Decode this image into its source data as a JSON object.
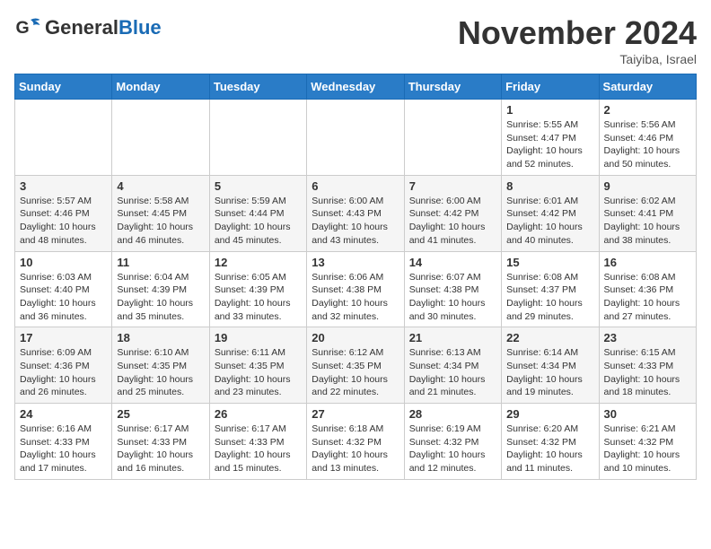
{
  "header": {
    "logo_general": "General",
    "logo_blue": "Blue",
    "month_title": "November 2024",
    "location": "Taiyiba, Israel"
  },
  "weekdays": [
    "Sunday",
    "Monday",
    "Tuesday",
    "Wednesday",
    "Thursday",
    "Friday",
    "Saturday"
  ],
  "weeks": [
    [
      {
        "day": "",
        "info": ""
      },
      {
        "day": "",
        "info": ""
      },
      {
        "day": "",
        "info": ""
      },
      {
        "day": "",
        "info": ""
      },
      {
        "day": "",
        "info": ""
      },
      {
        "day": "1",
        "info": "Sunrise: 5:55 AM\nSunset: 4:47 PM\nDaylight: 10 hours and 52 minutes."
      },
      {
        "day": "2",
        "info": "Sunrise: 5:56 AM\nSunset: 4:46 PM\nDaylight: 10 hours and 50 minutes."
      }
    ],
    [
      {
        "day": "3",
        "info": "Sunrise: 5:57 AM\nSunset: 4:46 PM\nDaylight: 10 hours and 48 minutes."
      },
      {
        "day": "4",
        "info": "Sunrise: 5:58 AM\nSunset: 4:45 PM\nDaylight: 10 hours and 46 minutes."
      },
      {
        "day": "5",
        "info": "Sunrise: 5:59 AM\nSunset: 4:44 PM\nDaylight: 10 hours and 45 minutes."
      },
      {
        "day": "6",
        "info": "Sunrise: 6:00 AM\nSunset: 4:43 PM\nDaylight: 10 hours and 43 minutes."
      },
      {
        "day": "7",
        "info": "Sunrise: 6:00 AM\nSunset: 4:42 PM\nDaylight: 10 hours and 41 minutes."
      },
      {
        "day": "8",
        "info": "Sunrise: 6:01 AM\nSunset: 4:42 PM\nDaylight: 10 hours and 40 minutes."
      },
      {
        "day": "9",
        "info": "Sunrise: 6:02 AM\nSunset: 4:41 PM\nDaylight: 10 hours and 38 minutes."
      }
    ],
    [
      {
        "day": "10",
        "info": "Sunrise: 6:03 AM\nSunset: 4:40 PM\nDaylight: 10 hours and 36 minutes."
      },
      {
        "day": "11",
        "info": "Sunrise: 6:04 AM\nSunset: 4:39 PM\nDaylight: 10 hours and 35 minutes."
      },
      {
        "day": "12",
        "info": "Sunrise: 6:05 AM\nSunset: 4:39 PM\nDaylight: 10 hours and 33 minutes."
      },
      {
        "day": "13",
        "info": "Sunrise: 6:06 AM\nSunset: 4:38 PM\nDaylight: 10 hours and 32 minutes."
      },
      {
        "day": "14",
        "info": "Sunrise: 6:07 AM\nSunset: 4:38 PM\nDaylight: 10 hours and 30 minutes."
      },
      {
        "day": "15",
        "info": "Sunrise: 6:08 AM\nSunset: 4:37 PM\nDaylight: 10 hours and 29 minutes."
      },
      {
        "day": "16",
        "info": "Sunrise: 6:08 AM\nSunset: 4:36 PM\nDaylight: 10 hours and 27 minutes."
      }
    ],
    [
      {
        "day": "17",
        "info": "Sunrise: 6:09 AM\nSunset: 4:36 PM\nDaylight: 10 hours and 26 minutes."
      },
      {
        "day": "18",
        "info": "Sunrise: 6:10 AM\nSunset: 4:35 PM\nDaylight: 10 hours and 25 minutes."
      },
      {
        "day": "19",
        "info": "Sunrise: 6:11 AM\nSunset: 4:35 PM\nDaylight: 10 hours and 23 minutes."
      },
      {
        "day": "20",
        "info": "Sunrise: 6:12 AM\nSunset: 4:35 PM\nDaylight: 10 hours and 22 minutes."
      },
      {
        "day": "21",
        "info": "Sunrise: 6:13 AM\nSunset: 4:34 PM\nDaylight: 10 hours and 21 minutes."
      },
      {
        "day": "22",
        "info": "Sunrise: 6:14 AM\nSunset: 4:34 PM\nDaylight: 10 hours and 19 minutes."
      },
      {
        "day": "23",
        "info": "Sunrise: 6:15 AM\nSunset: 4:33 PM\nDaylight: 10 hours and 18 minutes."
      }
    ],
    [
      {
        "day": "24",
        "info": "Sunrise: 6:16 AM\nSunset: 4:33 PM\nDaylight: 10 hours and 17 minutes."
      },
      {
        "day": "25",
        "info": "Sunrise: 6:17 AM\nSunset: 4:33 PM\nDaylight: 10 hours and 16 minutes."
      },
      {
        "day": "26",
        "info": "Sunrise: 6:17 AM\nSunset: 4:33 PM\nDaylight: 10 hours and 15 minutes."
      },
      {
        "day": "27",
        "info": "Sunrise: 6:18 AM\nSunset: 4:32 PM\nDaylight: 10 hours and 13 minutes."
      },
      {
        "day": "28",
        "info": "Sunrise: 6:19 AM\nSunset: 4:32 PM\nDaylight: 10 hours and 12 minutes."
      },
      {
        "day": "29",
        "info": "Sunrise: 6:20 AM\nSunset: 4:32 PM\nDaylight: 10 hours and 11 minutes."
      },
      {
        "day": "30",
        "info": "Sunrise: 6:21 AM\nSunset: 4:32 PM\nDaylight: 10 hours and 10 minutes."
      }
    ]
  ]
}
